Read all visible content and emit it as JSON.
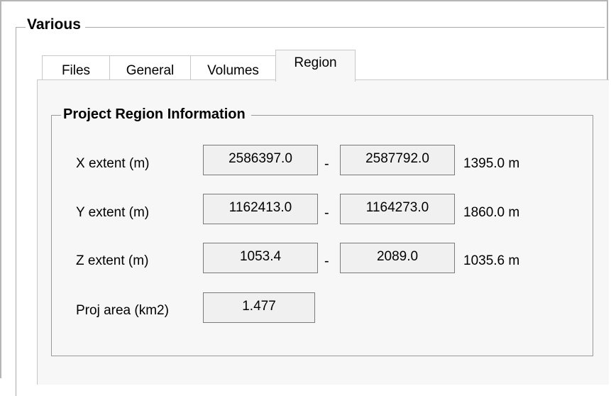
{
  "group_title": "Various",
  "tabs": [
    {
      "label": "Files",
      "selected": false
    },
    {
      "label": "General",
      "selected": false
    },
    {
      "label": "Volumes",
      "selected": false
    },
    {
      "label": "Region",
      "selected": true
    }
  ],
  "region_group": {
    "title": "Project Region Information",
    "rows": [
      {
        "label": "X extent (m)",
        "min": "2586397.0",
        "separator": "-",
        "max": "2587792.0",
        "extent": "1395.0 m"
      },
      {
        "label": "Y extent (m)",
        "min": "1162413.0",
        "separator": "-",
        "max": "1164273.0",
        "extent": "1860.0 m"
      },
      {
        "label": "Z extent (m)",
        "min": "1053.4",
        "separator": "-",
        "max": "2089.0",
        "extent": "1035.6 m"
      }
    ],
    "area": {
      "label": "Proj area (km2)",
      "value": "1.477"
    }
  }
}
